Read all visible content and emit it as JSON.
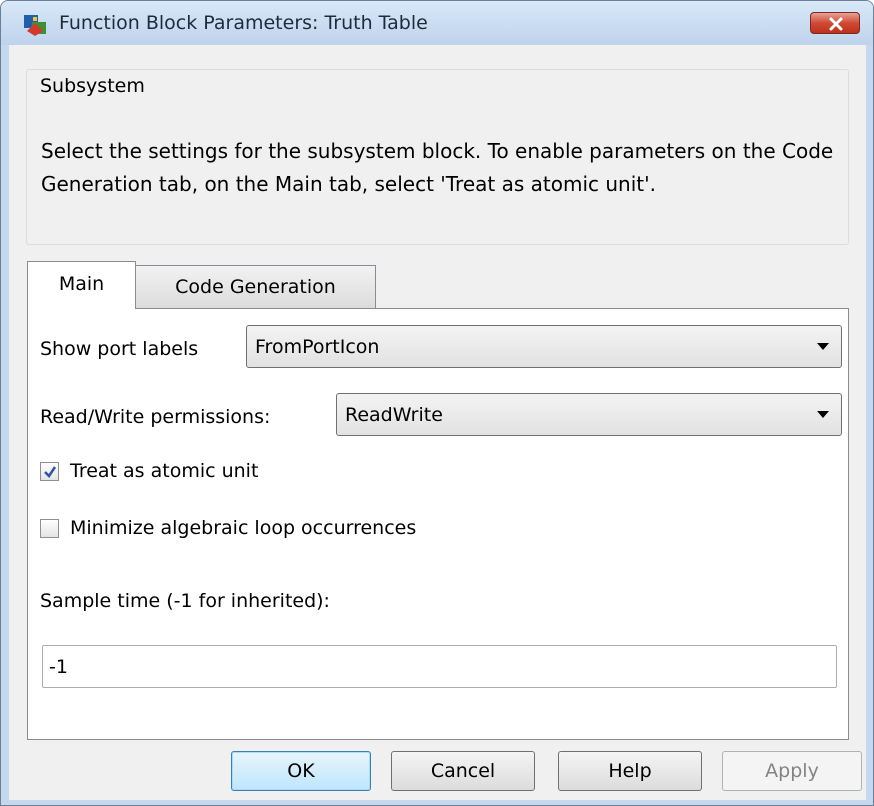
{
  "window": {
    "title": "Function Block Parameters: Truth Table"
  },
  "group": {
    "title": "Subsystem",
    "description": "Select the settings for the subsystem block. To enable parameters on the Code Generation tab, on the Main tab, select 'Treat as atomic unit'."
  },
  "tabs": [
    {
      "label": "Main",
      "selected": true
    },
    {
      "label": "Code Generation",
      "selected": false
    }
  ],
  "main": {
    "show_port_labels": {
      "label": "Show port labels",
      "value": "FromPortIcon"
    },
    "read_write_permissions": {
      "label": "Read/Write permissions:",
      "value": "ReadWrite"
    },
    "treat_atomic": {
      "label": "Treat as atomic unit",
      "checked": true
    },
    "minimize_loop": {
      "label": "Minimize algebraic loop occurrences",
      "checked": false
    },
    "sample_time": {
      "label": "Sample time (-1 for inherited):",
      "value": "-1"
    }
  },
  "buttons": {
    "ok": "OK",
    "cancel": "Cancel",
    "help": "Help",
    "apply": "Apply"
  },
  "colors": {
    "titlebar": "#c4d8ee",
    "close_button": "#c0301c",
    "checkmark": "#2c55a8",
    "default_button_border": "#3c7fb1"
  }
}
